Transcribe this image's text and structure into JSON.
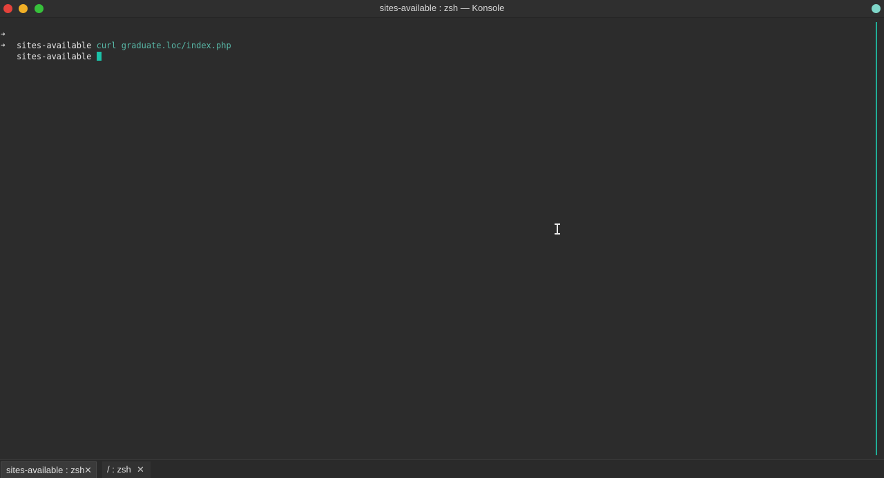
{
  "window": {
    "title": "sites-available : zsh — Konsole",
    "accent": "#1fae98"
  },
  "terminal": {
    "lines": [
      {
        "prompt_icon": "➜",
        "cwd": "sites-available",
        "command": "curl graduate.loc/index.php"
      },
      {
        "prompt_icon": "➜",
        "cwd": "sites-available",
        "command": ""
      }
    ]
  },
  "tabs": [
    {
      "label": "sites-available : zsh",
      "close": "✕",
      "active": true
    },
    {
      "label": "/ : zsh",
      "close": "✕",
      "active": false
    }
  ],
  "icons": {
    "close": "close-window-icon",
    "minimize": "minimize-window-icon",
    "maximize": "maximize-window-icon",
    "app": "app-menu-icon",
    "cursor": "text-cursor-icon"
  }
}
